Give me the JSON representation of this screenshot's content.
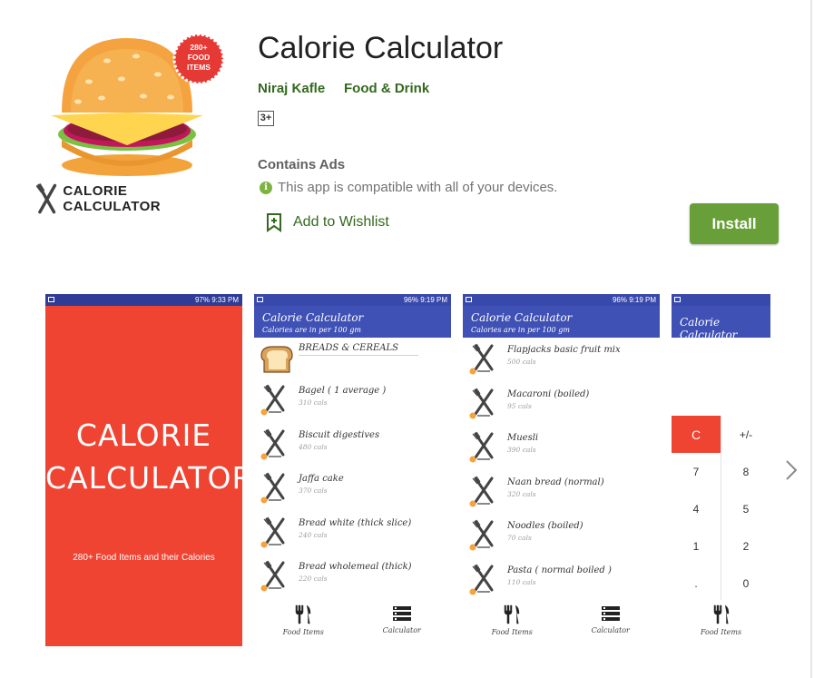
{
  "app": {
    "title": "Calorie Calculator",
    "developer": "Niraj Kafle",
    "category": "Food & Drink",
    "content_rating": "3+",
    "contains_ads": "Contains Ads",
    "compatibility": "This app is compatible with all of your devices.",
    "wishlist_label": "Add to Wishlist",
    "install_label": "Install",
    "icon_caption": "CALORIE CALCULATOR",
    "icon_badge": [
      "280+",
      "FOOD",
      "ITEMS"
    ],
    "accent_color": "#689f38",
    "link_color": "#33691e"
  },
  "screenshots": {
    "splash": {
      "status": "97% 9:33 PM",
      "title_line1": "CALORIE",
      "title_line2": "CALCULATOR",
      "subtitle": "280+ Food Items and their Calories",
      "background": "#f04433"
    },
    "list1": {
      "status": "96% 9:19 PM",
      "appbar_title": "Calorie Calculator",
      "appbar_subtitle": "Calories are in per 100 gm",
      "category": "BREADS & CEREALS",
      "items": [
        {
          "name": "Bagel ( 1 average )",
          "cals": "310 cals"
        },
        {
          "name": "Biscuit digestives",
          "cals": "480 cals"
        },
        {
          "name": "Jaffa cake",
          "cals": "370 cals"
        },
        {
          "name": "Bread white (thick slice)",
          "cals": "240 cals"
        },
        {
          "name": "Bread wholemeal (thick)",
          "cals": "220 cals"
        }
      ],
      "nav": [
        "Food Items",
        "Calculator"
      ]
    },
    "list2": {
      "status": "96% 9:19 PM",
      "appbar_title": "Calorie Calculator",
      "appbar_subtitle": "Calories are in per 100 gm",
      "items": [
        {
          "name": "Flapjacks basic fruit mix",
          "cals": "500 cals"
        },
        {
          "name": "Macaroni (boiled)",
          "cals": "95 cals"
        },
        {
          "name": "Muesli",
          "cals": "390 cals"
        },
        {
          "name": "Naan bread (normal)",
          "cals": "320 cals"
        },
        {
          "name": "Noodles (boiled)",
          "cals": "70 cals"
        },
        {
          "name": "Pasta ( normal boiled )",
          "cals": "110 cals"
        }
      ],
      "nav": [
        "Food Items",
        "Calculator"
      ]
    },
    "calculator": {
      "appbar_title": "Calorie Calculator",
      "keys": [
        "C",
        "+/-",
        "7",
        "8",
        "4",
        "5",
        "1",
        "2",
        ".",
        "0"
      ],
      "nav": [
        "Food Items"
      ]
    }
  }
}
